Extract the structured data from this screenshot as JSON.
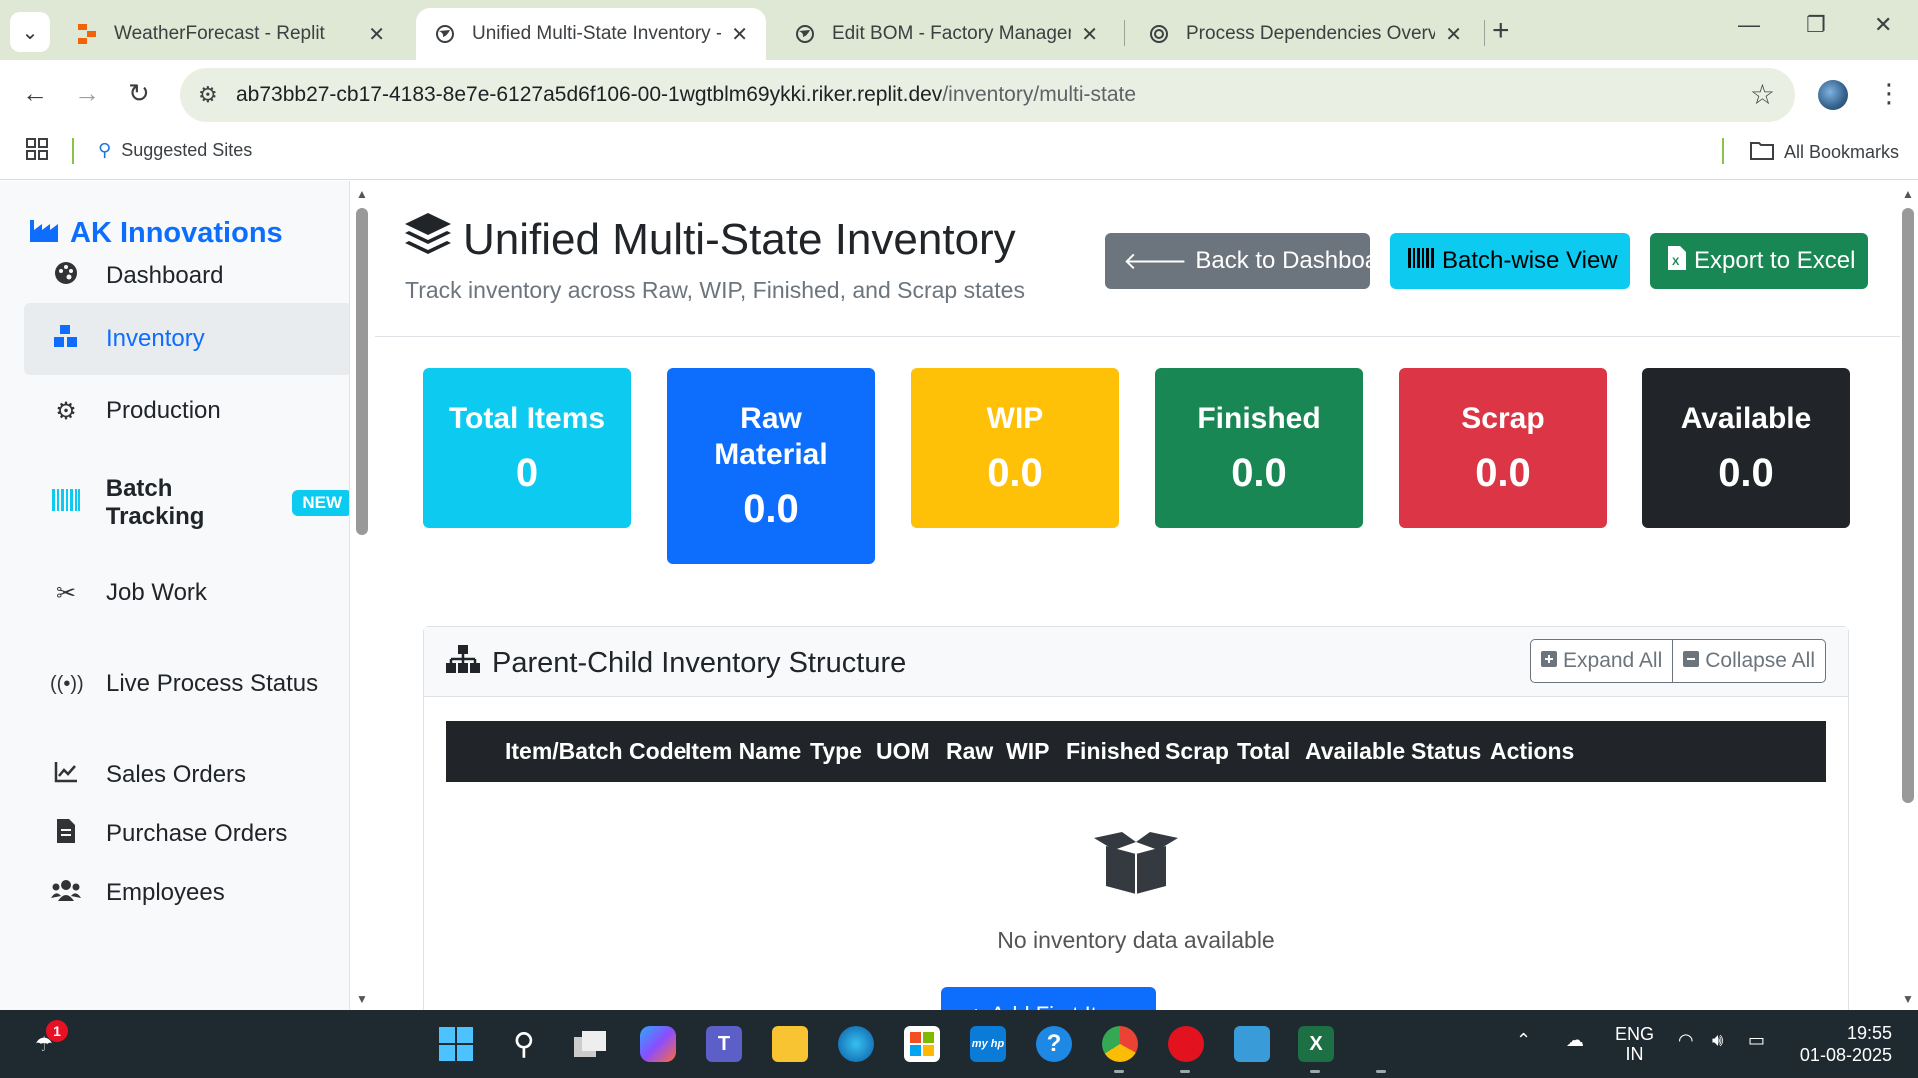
{
  "browser": {
    "tabs": [
      {
        "title": "WeatherForecast - Replit",
        "icon": "replit-icon"
      },
      {
        "title": "Unified Multi-State Inventory - A",
        "icon": "globe-icon"
      },
      {
        "title": "Edit BOM - Factory Managemen",
        "icon": "globe-icon"
      },
      {
        "title": "Process Dependencies Overview",
        "icon": "openai-icon"
      }
    ],
    "url_host": "ab73bb27-cb17-4183-8e7e-6127a5d6f106-00-1wgtblm69ykki.riker.replit.dev",
    "url_path": "/inventory/multi-state",
    "bookmarks": {
      "suggested": "Suggested Sites",
      "all": "All Bookmarks"
    }
  },
  "sidebar": {
    "brand": "AK Innovations",
    "items": [
      {
        "label": "Dashboard",
        "icon": "palette-icon"
      },
      {
        "label": "Inventory",
        "icon": "cubes-icon"
      },
      {
        "label": "Production",
        "icon": "cogs-icon"
      },
      {
        "label": "Batch Tracking",
        "icon": "barcode-icon",
        "badge": "NEW"
      },
      {
        "label": "Job Work",
        "icon": "tools-icon"
      },
      {
        "label": "Live Process Status",
        "icon": "broadcast-icon"
      },
      {
        "label": "Sales Orders",
        "icon": "chart-line-icon"
      },
      {
        "label": "Purchase Orders",
        "icon": "invoice-icon"
      },
      {
        "label": "Employees",
        "icon": "users-icon"
      }
    ]
  },
  "header": {
    "title": "Unified Multi-State Inventory",
    "subtitle": "Track inventory across Raw, WIP, Finished, and Scrap states",
    "buttons": {
      "back": "Back to Dashboard",
      "batch": "Batch-wise View",
      "export": "Export to Excel"
    }
  },
  "stats": [
    {
      "label": "Total Items",
      "value": "0",
      "color": "#0dcaf0"
    },
    {
      "label": "Raw Material",
      "value": "0.0",
      "color": "#0d6efd"
    },
    {
      "label": "WIP",
      "value": "0.0",
      "color": "#ffc107"
    },
    {
      "label": "Finished",
      "value": "0.0",
      "color": "#198754"
    },
    {
      "label": "Scrap",
      "value": "0.0",
      "color": "#dc3545"
    },
    {
      "label": "Available",
      "value": "0.0",
      "color": "#212529"
    }
  ],
  "structure": {
    "title": "Parent-Child Inventory Structure",
    "expand": "Expand All",
    "collapse": "Collapse All",
    "columns": [
      "Item/Batch Code",
      "Item Name",
      "Type",
      "UOM",
      "Raw",
      "WIP",
      "Finished",
      "Scrap",
      "Total",
      "Available",
      "Status",
      "Actions"
    ],
    "empty": "No inventory data available",
    "add_button": "Add First Item"
  },
  "taskbar": {
    "lang": "ENG",
    "region": "IN",
    "time": "19:55",
    "date": "01-08-2025",
    "weather_badge": "1"
  }
}
